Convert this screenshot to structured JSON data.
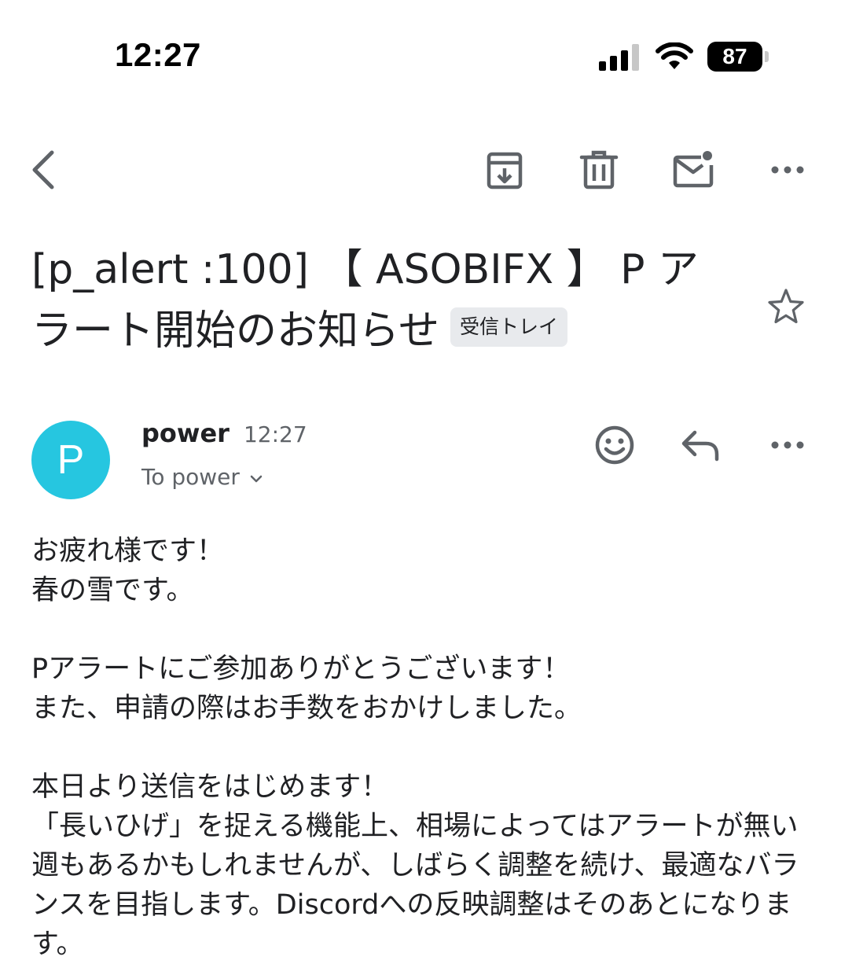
{
  "status_bar": {
    "time": "12:27",
    "battery": "87"
  },
  "toolbar": {
    "back": "back-icon",
    "archive": "archive-icon",
    "delete": "trash-icon",
    "mark_unread": "mark-unread-icon",
    "more": "more-icon"
  },
  "email": {
    "subject": "[p_alert :100] 【 ASOBIFX 】 P アラート開始のお知らせ",
    "label": "受信トレイ",
    "sender_initial": "P",
    "sender_name": "power",
    "sent_time": "12:27",
    "recipient": "To power",
    "body": [
      "お疲れ様です！",
      "春の雪です。",
      "",
      "Pアラートにご参加ありがとうございます！",
      "また、申請の際はお手数をおかけしました。",
      "",
      "本日より送信をはじめます！",
      "「長いひげ」を捉える機能上、相場によってはアラートが無い週もあるかもしれませんが、しばらく調整を続け、最適なバランスを目指します。Discordへの反映調整はそのあとになります。"
    ]
  },
  "colors": {
    "avatar": "#26c6e0",
    "chip_bg": "#e8eaed",
    "icon_gray": "#5f6368",
    "text": "#202124"
  }
}
